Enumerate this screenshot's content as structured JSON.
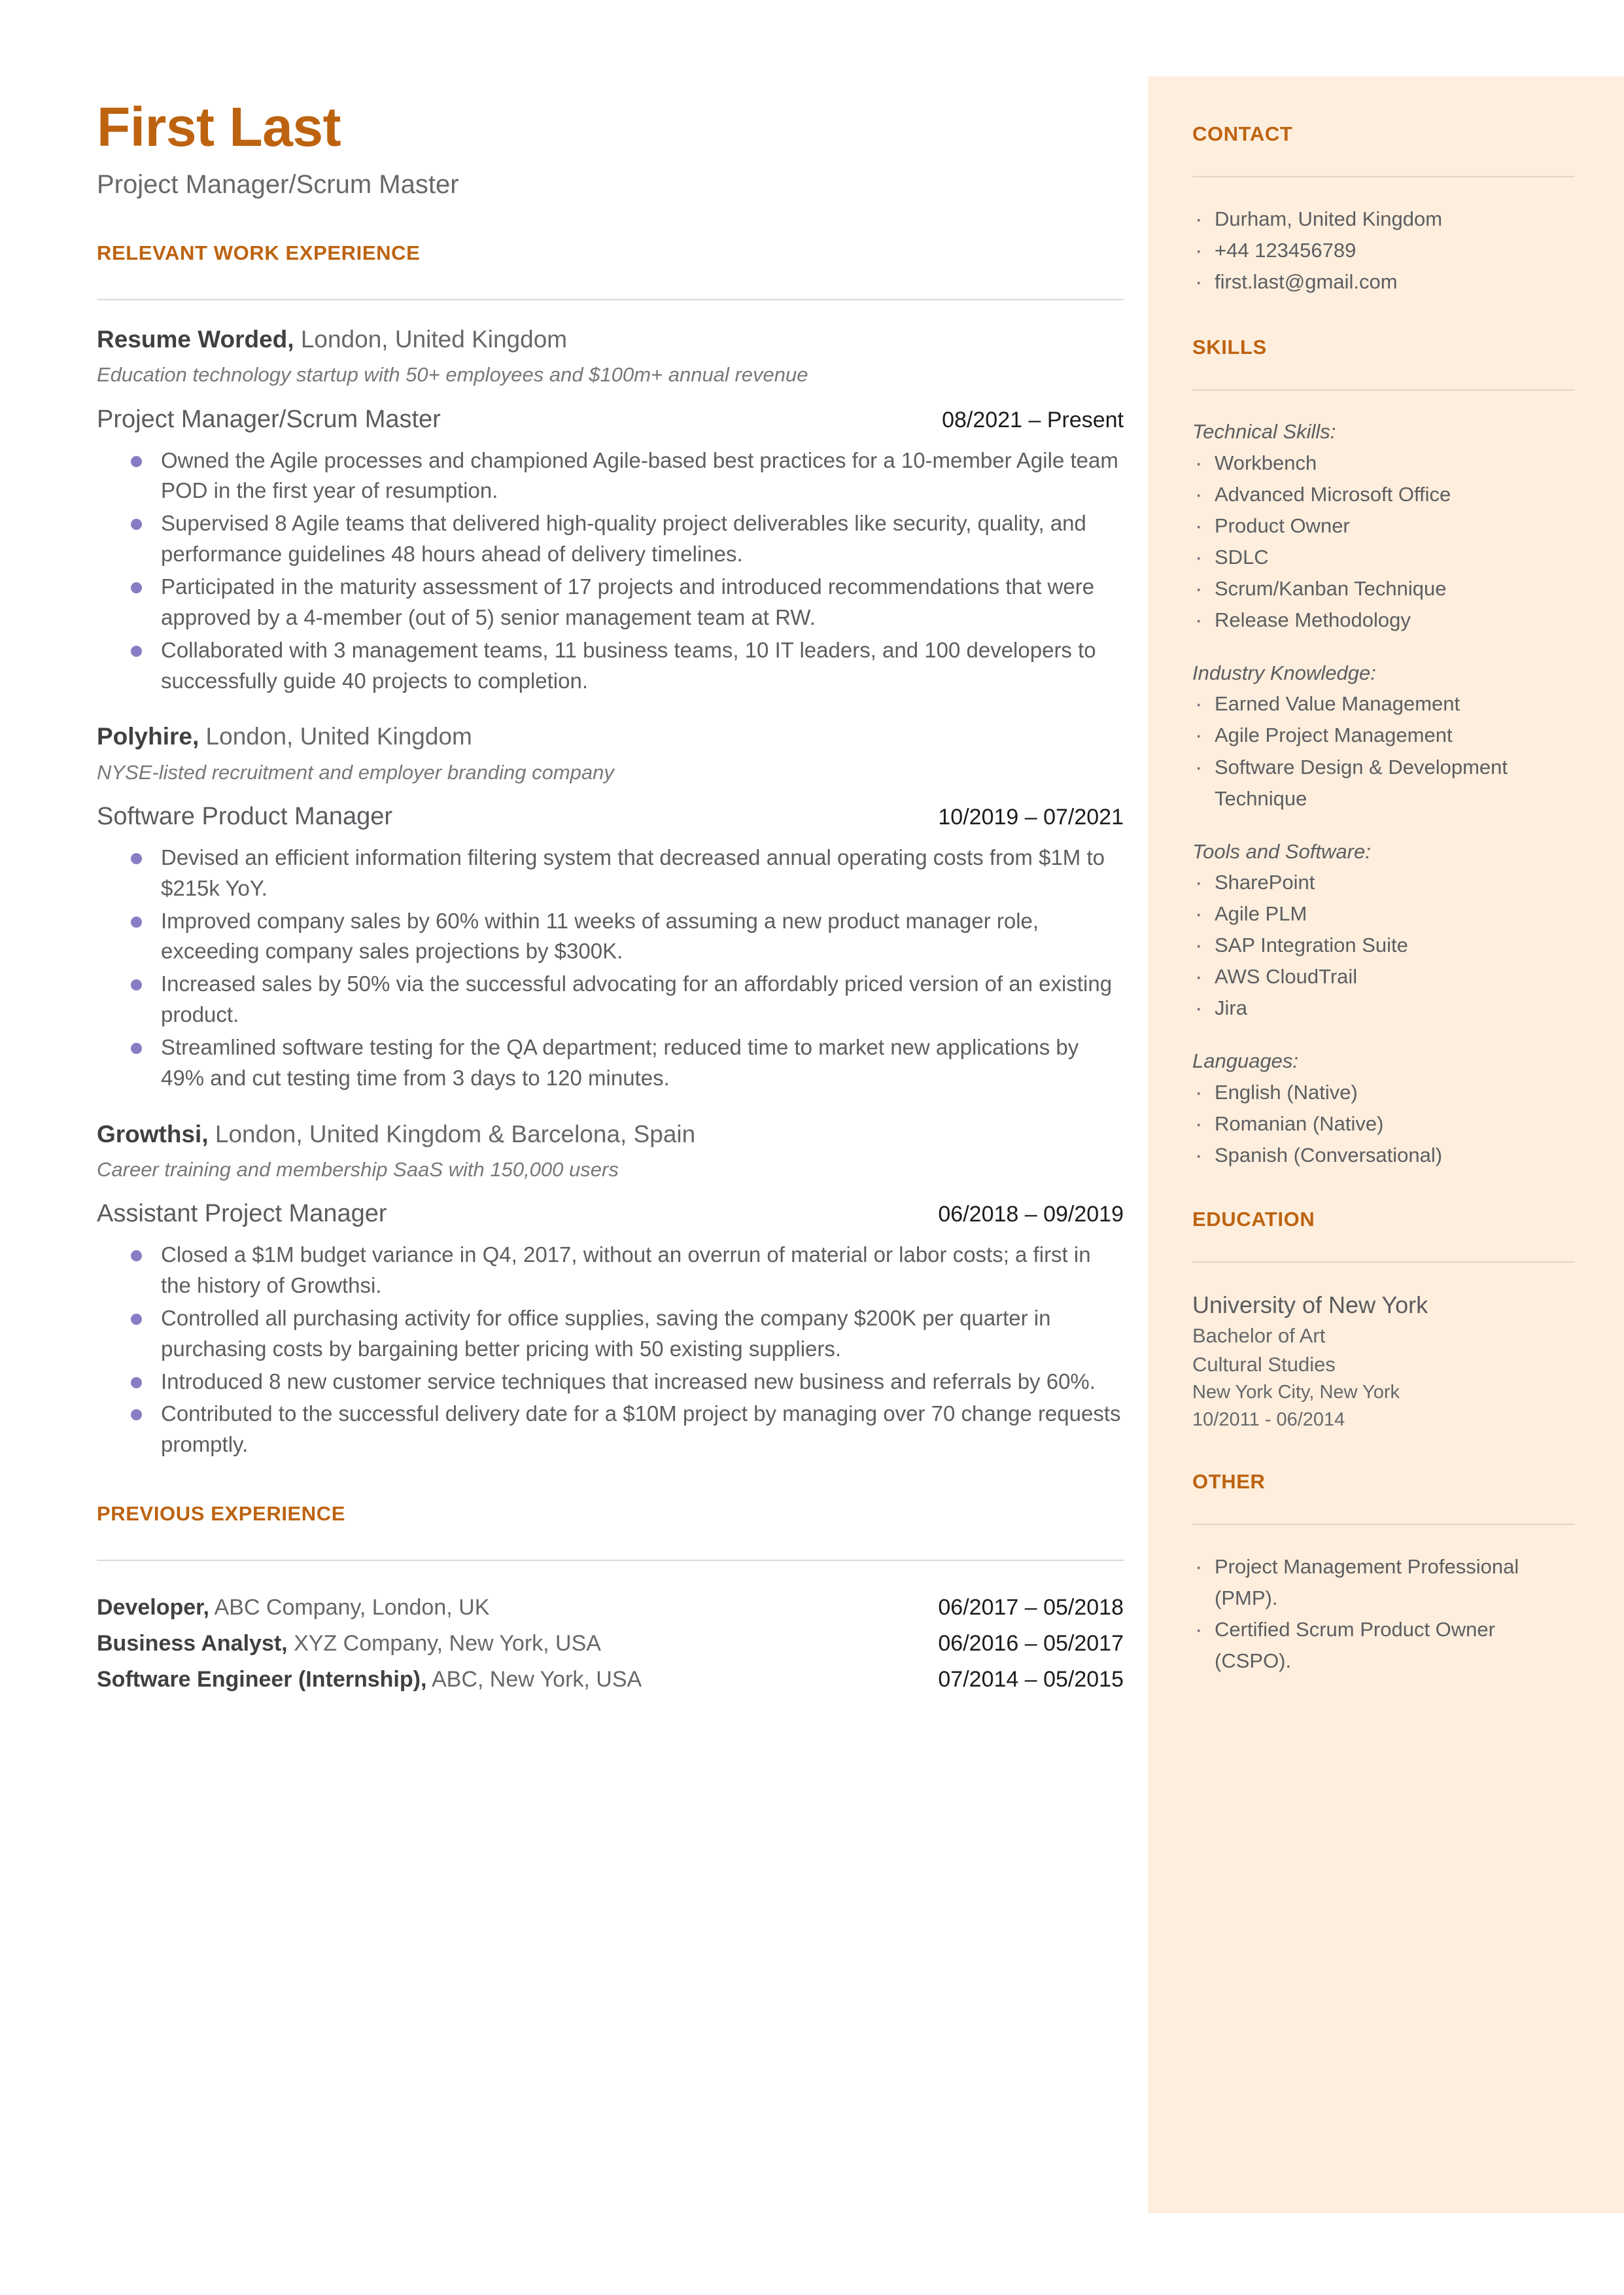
{
  "theme": {
    "accent": "#BD6310",
    "sidebar_bg": "#FDEEDD",
    "bullet": "#8A7CC4",
    "body_text": "#5C5E61"
  },
  "header": {
    "name": "First Last",
    "headline": "Project Manager/Scrum Master"
  },
  "work_section": {
    "title": "RELEVANT WORK EXPERIENCE",
    "jobs": [
      {
        "company": "Resume Worded,",
        "location": " London, United Kingdom",
        "description": "Education technology startup with 50+ employees and $100m+ annual revenue",
        "role": "Project Manager/Scrum Master",
        "dates": "08/2021 – Present",
        "bullets": [
          "Owned the Agile processes and championed Agile-based best practices for a 10-member Agile team POD in the first year of resumption.",
          "Supervised 8 Agile teams that delivered high-quality project deliverables like security, quality, and performance guidelines 48 hours ahead of delivery timelines.",
          "Participated in the maturity assessment of 17 projects and introduced recommendations that were approved by a 4-member (out of 5) senior management team at RW.",
          "Collaborated with 3 management teams, 11 business teams, 10 IT leaders, and 100 developers to successfully guide 40 projects to completion."
        ]
      },
      {
        "company": "Polyhire,",
        "location": " London, United Kingdom",
        "description": "NYSE-listed recruitment and employer branding company",
        "role": "Software Product Manager",
        "dates": "10/2019 – 07/2021",
        "bullets": [
          "Devised an efficient information filtering system that decreased annual operating costs from $1M to $215k YoY.",
          "Improved company sales by 60% within 11 weeks of assuming a new product manager role, exceeding company sales projections by $300K.",
          "Increased sales by 50% via the successful advocating for an affordably priced version of an existing product.",
          "Streamlined software testing for the QA department; reduced time to market new applications by 49% and cut testing time from 3 days to 120 minutes."
        ]
      },
      {
        "company": "Growthsi,",
        "location": " London, United Kingdom & Barcelona, Spain",
        "description": "Career training and membership SaaS with 150,000 users",
        "role": "Assistant Project Manager",
        "dates": "06/2018 – 09/2019",
        "bullets": [
          "Closed a $1M budget variance in Q4, 2017, without an overrun of material or labor costs; a first in the history of Growthsi.",
          "Controlled all purchasing activity for office supplies, saving the company $200K per quarter in purchasing costs by bargaining better pricing with 50 existing suppliers.",
          "Introduced 8 new customer service techniques that increased new business and referrals by 60%.",
          "Contributed to the successful delivery date for a $10M project by managing over 70 change requests promptly."
        ]
      }
    ]
  },
  "previous_section": {
    "title": "PREVIOUS EXPERIENCE",
    "rows": [
      {
        "role": "Developer,",
        "detail": " ABC Company, London, UK",
        "dates": "06/2017 – 05/2018"
      },
      {
        "role": "Business Analyst,",
        "detail": " XYZ Company, New York, USA",
        "dates": "06/2016 – 05/2017"
      },
      {
        "role": "Software Engineer (Internship),",
        "detail": " ABC, New York, USA",
        "dates": "07/2014 – 05/2015"
      }
    ]
  },
  "contact": {
    "title": "CONTACT",
    "items": [
      "Durham, United Kingdom",
      "+44 123456789",
      "first.last@gmail.com"
    ]
  },
  "skills": {
    "title": "SKILLS",
    "groups": [
      {
        "label": "Technical Skills:",
        "items": [
          "Workbench",
          "Advanced Microsoft Office",
          "Product Owner",
          "SDLC",
          "Scrum/Kanban Technique",
          "Release Methodology"
        ]
      },
      {
        "label": "Industry Knowledge:",
        "items": [
          "Earned Value Management",
          "Agile Project Management",
          "Software Design & Development Technique"
        ]
      },
      {
        "label": "Tools and Software:",
        "items": [
          "SharePoint",
          "Agile PLM",
          "SAP Integration Suite",
          "AWS CloudTrail",
          "Jira"
        ]
      },
      {
        "label": "Languages:",
        "items": [
          "English (Native)",
          "Romanian (Native)",
          "Spanish (Conversational)"
        ]
      }
    ]
  },
  "education": {
    "title": "EDUCATION",
    "school": "University of New York",
    "degree": "Bachelor of Art",
    "field": "Cultural Studies",
    "location": "New York City, New York",
    "dates": "10/2011 - 06/2014"
  },
  "other": {
    "title": "OTHER",
    "items": [
      "Project Management Professional (PMP).",
      "Certified Scrum Product Owner (CSPO)."
    ]
  }
}
